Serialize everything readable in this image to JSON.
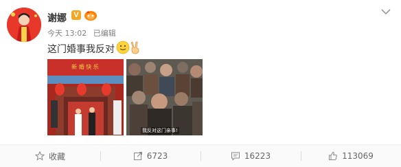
{
  "post": {
    "author": "谢娜",
    "verified_badge": "V",
    "time": "今天 13:02",
    "edited": "已编辑",
    "text": "这门婚事我反对",
    "emojis": [
      "smiley-face-emoji",
      "victory-hand-emoji"
    ],
    "image2_caption": "我反对这门亲事!",
    "image1_banner": "新 婚 快 乐"
  },
  "actions": {
    "favorite": "收藏",
    "repost": "6723",
    "comment": "16223",
    "like": "113069"
  },
  "colors": {
    "verified": "#f5a623",
    "avatar_bg": "#e8382b",
    "meta_text": "#808080",
    "action_text": "#666666"
  }
}
